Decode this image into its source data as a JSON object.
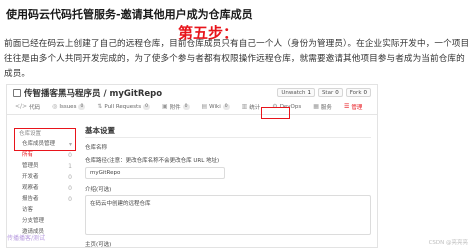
{
  "heading": {
    "title": "使用码云代码托管服务-邀请其他用户成为仓库成员",
    "step": "第五步："
  },
  "paragraph": "前面已经在码云上创建了自己的远程仓库，目前仓库成员只有自己一个人（身份为管理员）。在企业实际开发中，一个项目往往是由多个人共同开发完成的，为了使多个参与者都有权限操作远程仓库，就需要邀请其他项目参与者成为当前仓库的成员。",
  "screenshot": {
    "repo": {
      "title": "传智播客黑马程序员 / myGitRepo",
      "unwatch_label": "Unwatch",
      "unwatch_count": "1",
      "star_label": "Star",
      "star_count": "0",
      "fork_label": "Fork",
      "fork_count": "0"
    },
    "tabs": [
      {
        "icon": "</>",
        "label": "代码",
        "badge": ""
      },
      {
        "icon": "◎",
        "label": "Issues",
        "badge": "0"
      },
      {
        "icon": "⇅",
        "label": "Pull Requests",
        "badge": "0"
      },
      {
        "icon": "▣",
        "label": "附件",
        "badge": "0"
      },
      {
        "icon": "▤",
        "label": "Wiki",
        "badge": "0"
      },
      {
        "icon": "▥",
        "label": "统计",
        "badge": ""
      },
      {
        "icon": "⚙",
        "label": "DevOps",
        "badge": ""
      },
      {
        "icon": "▦",
        "label": "服务",
        "badge": ""
      },
      {
        "icon": "☰",
        "label": "管理",
        "badge": ""
      }
    ],
    "sidebar": {
      "heading": "仓库设置",
      "items": [
        {
          "label": "仓库成员管理",
          "chev": "▾"
        },
        {
          "label": "所有",
          "chev": "0"
        },
        {
          "label": "管理员",
          "chev": "1"
        },
        {
          "label": "开发者",
          "chev": "0"
        },
        {
          "label": "观察者",
          "chev": "0"
        },
        {
          "label": "报告者",
          "chev": "0"
        },
        {
          "label": "访客",
          "chev": ""
        },
        {
          "label": "分支管理",
          "chev": ""
        },
        {
          "label": "邀请成员",
          "chev": ""
        }
      ],
      "cover": "传播播客/测试"
    },
    "main": {
      "section_title": "基本设置",
      "name_label": "仓库名称",
      "path_label": "仓库路径(注意：更改仓库名称不会更改仓库 URL 地址)",
      "path_value": "myGitRepo",
      "desc_label": "介绍(可选)",
      "desc_value": "在码云中创建的远程仓库",
      "home_label": "主页(可选)"
    }
  },
  "watermark": "CSDN @亮亮亮"
}
